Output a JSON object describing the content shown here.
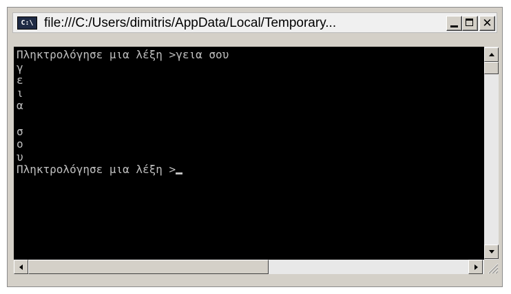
{
  "window": {
    "title": "file:///C:/Users/dimitris/AppData/Local/Temporary...",
    "icon_text": "C:\\",
    "icon": "console-icon",
    "buttons": {
      "minimize": "minimize-icon",
      "maximize": "maximize-icon",
      "close": "close-icon"
    }
  },
  "console": {
    "lines": [
      "Πληκτρολόγησε μια λέξη >γεια σου",
      "γ",
      "ε",
      "ι",
      "α",
      "",
      "σ",
      "ο",
      "υ",
      "Πληκτρολόγησε μια λέξη >"
    ],
    "text_color": "#c0c0c0",
    "background": "#000000"
  },
  "scrollbars": {
    "vertical": {
      "up": "scroll-up-arrow",
      "down": "scroll-down-arrow"
    },
    "horizontal": {
      "left": "scroll-left-arrow",
      "right": "scroll-right-arrow"
    }
  }
}
